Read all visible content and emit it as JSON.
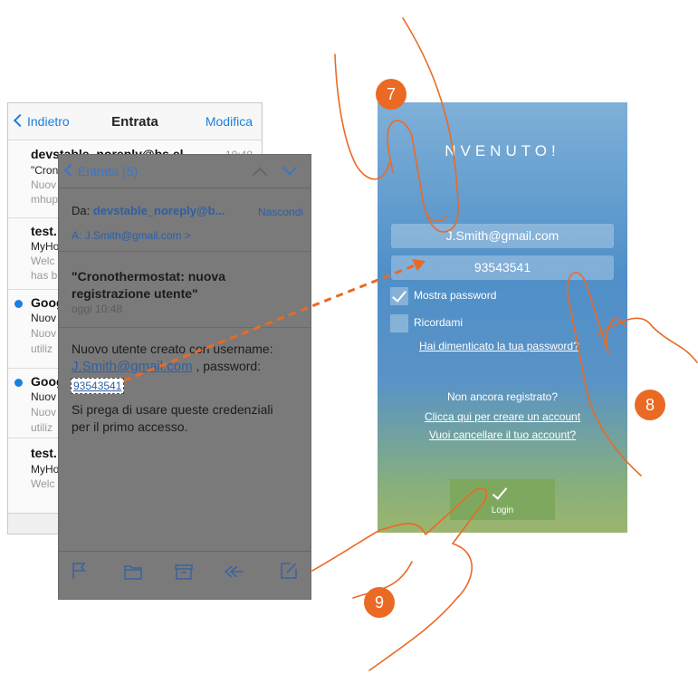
{
  "mail_list": {
    "back_label": "Indietro",
    "title": "Entrata",
    "edit_label": "Modifica",
    "rows": [
      {
        "sender": "devstable_noreply@bs.el...",
        "time": "10:48",
        "line2": "\"Cron",
        "line3": "Nuov",
        "line4": "mhup",
        "unread": false
      },
      {
        "sender": "test.",
        "time": "",
        "line2": "MyHo",
        "line3": "Welc",
        "line4": "has b",
        "unread": false
      },
      {
        "sender": "Goog",
        "time": "",
        "line2": "Nuov",
        "line3": "Nuov",
        "line4": "utiliz",
        "unread": true
      },
      {
        "sender": "Goog",
        "time": "",
        "line2": "Nuov",
        "line3": "Nuov",
        "line4": "utiliz",
        "unread": true
      },
      {
        "sender": "test.",
        "time": "",
        "line2": "MyHo",
        "line3": "Welc",
        "line4": "",
        "unread": false
      }
    ]
  },
  "mail_detail": {
    "back_label": "Entrata (5)",
    "from_prefix": "Da: ",
    "from_value": "devstable_noreply@b...",
    "hide_label": "Nascondi",
    "to_line": "A: J.Smith@gmail.com >",
    "subject_line1": "\"Cronothermostat: nuova",
    "subject_line2": "registrazione utente\"",
    "date": "oggi 10:48",
    "body_line1": "Nuovo utente creato con username:",
    "body_username": "J.Smith@gmail.com",
    "body_password_prefix": " , password:",
    "body_password": "93543541",
    "body_line3": "Si prega di usare queste credenziali",
    "body_line4": "per il primo accesso.",
    "toolbar_icons": [
      "flag-icon",
      "folder-icon",
      "archive-icon",
      "reply-icon",
      "compose-icon"
    ]
  },
  "phone": {
    "welcome": "NVENUTO!",
    "email_value": "J.Smith@gmail.com",
    "password_value": "93543541",
    "show_password_label": "Mostra password",
    "show_password_checked": true,
    "remember_label": "Ricordami",
    "remember_checked": false,
    "forgot_label": "Hai dimenticato la tua password?",
    "not_registered": "Non ancora registrato?",
    "create_account": "Clicca qui per creare un account",
    "delete_account": "Vuoi cancellare il tuo account?",
    "login_label": "Login"
  },
  "steps": {
    "step7": "7",
    "step8": "8",
    "step9": "9"
  },
  "colors": {
    "badge": "#ea6a24",
    "arrow": "#ea6a24",
    "link_blue": "#1a7fe0",
    "login_green": "#7ea85e"
  }
}
